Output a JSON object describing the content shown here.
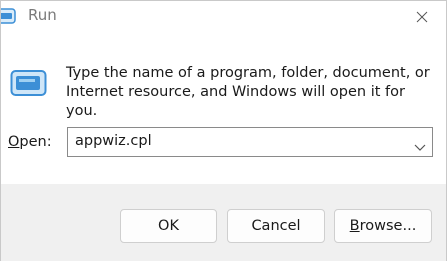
{
  "window": {
    "title": "Run"
  },
  "dialog": {
    "description": "Type the name of a program, folder, document, or Internet resource, and Windows will open it for you.",
    "open_label_accel": "O",
    "open_label_rest": "pen:",
    "open_value": "appwiz.cpl"
  },
  "buttons": {
    "ok": "OK",
    "cancel": "Cancel",
    "browse_accel": "B",
    "browse_rest": "rowse..."
  },
  "icons": {
    "title": "run-app-icon",
    "content": "run-app-icon",
    "close": "close-icon",
    "dropdown": "chevron-down-icon"
  },
  "colors": {
    "accent": "#3c8fd6",
    "footer_bg": "#f0f0f0",
    "title_text": "#7a7a7a"
  }
}
